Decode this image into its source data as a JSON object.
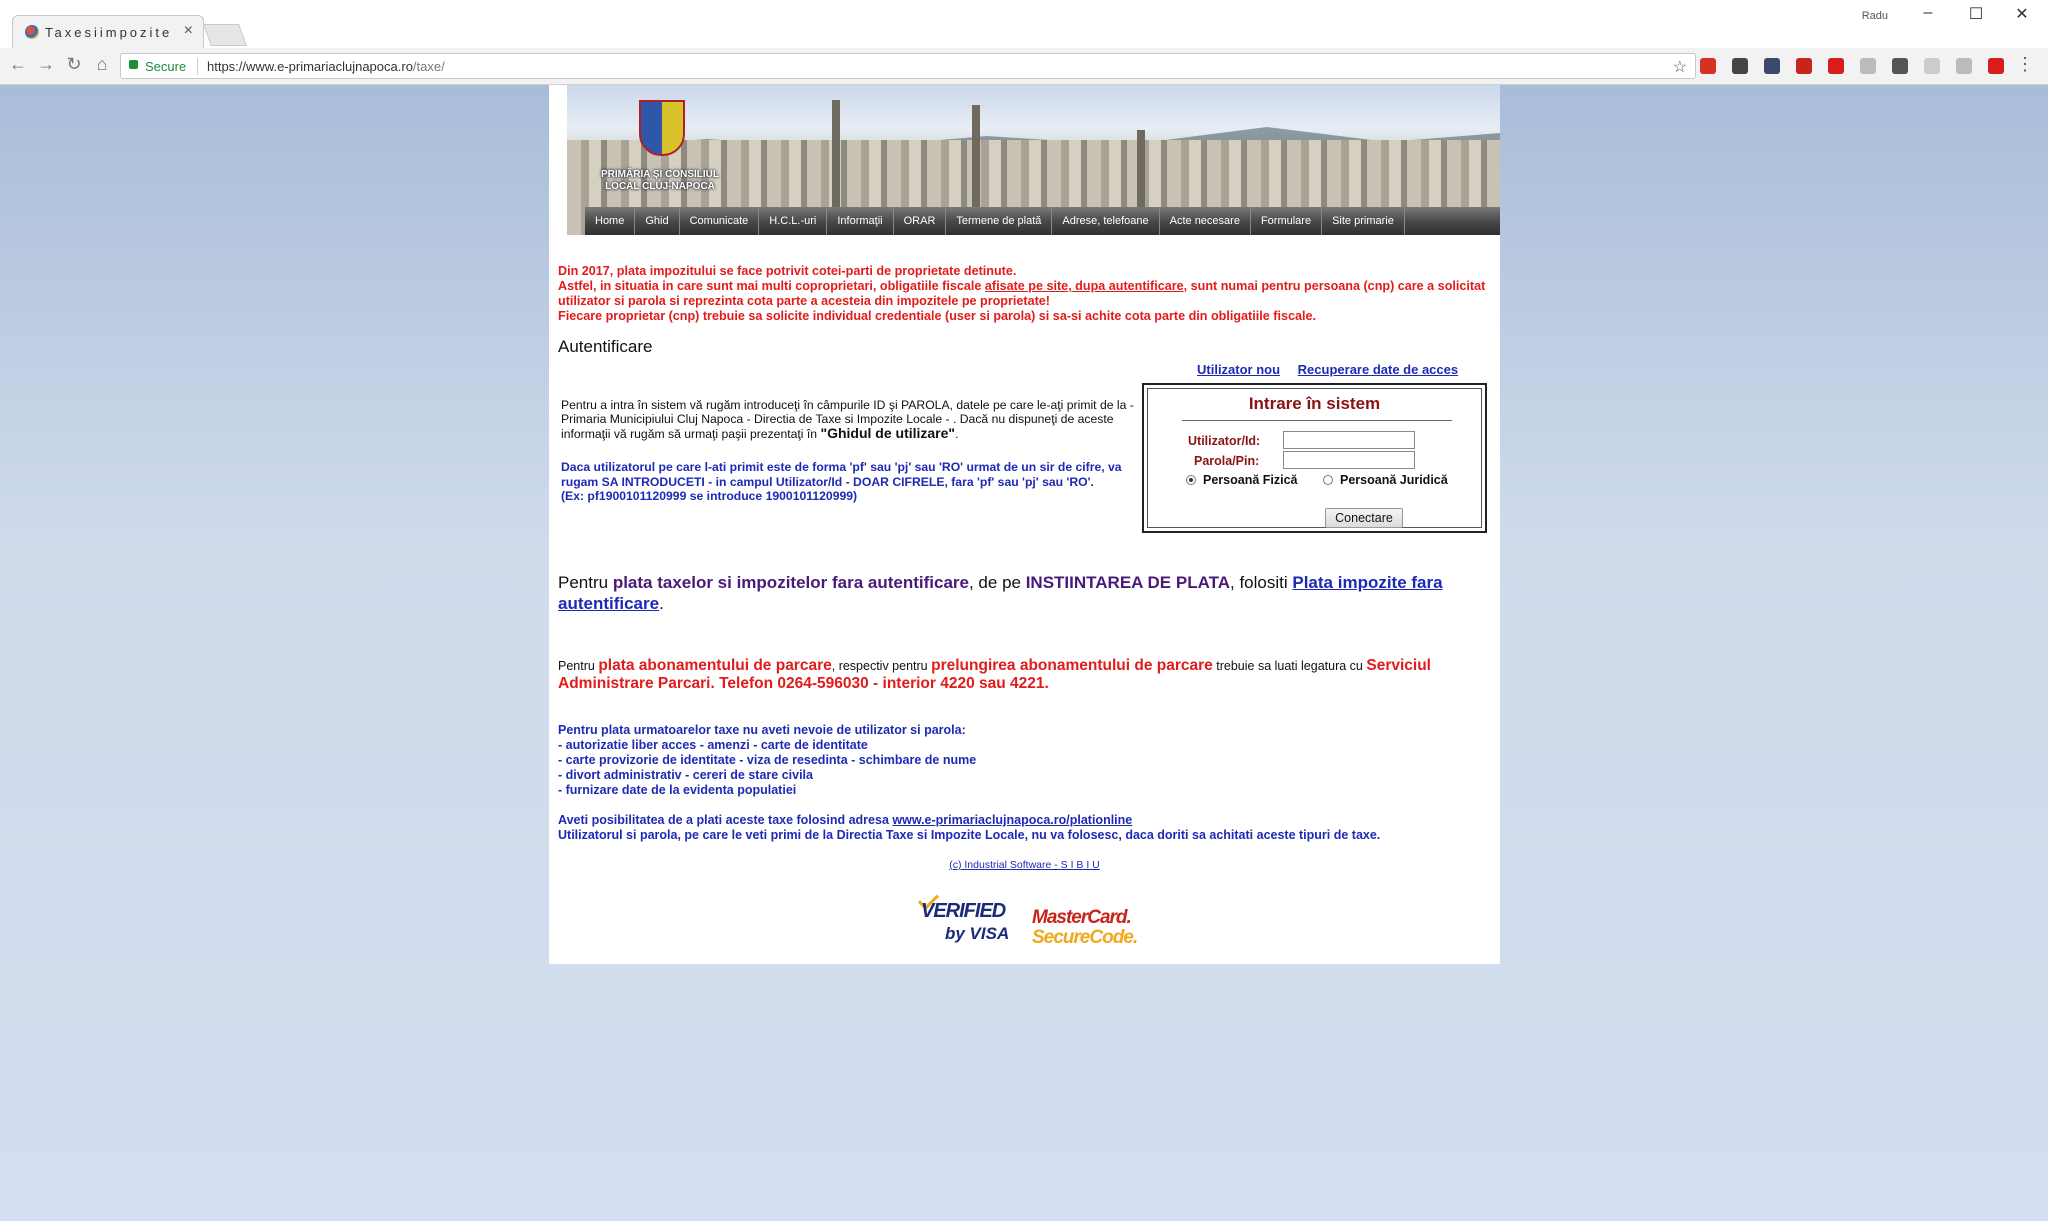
{
  "browser": {
    "tab_title": "Taxesiimpozite",
    "tab_close": "×",
    "user_name": "Radu",
    "window_controls": [
      "–",
      "☐",
      "✕"
    ],
    "secure_label": "Secure",
    "url_base": "https://www.e-primariaclujnapoca.ro",
    "url_path": "/taxe/",
    "extensions": [
      {
        "name": "gmail-icon",
        "color": "#d93025"
      },
      {
        "name": "pocket-icon",
        "color": "#444444"
      },
      {
        "name": "cloud-icon",
        "color": "#3a4a6a"
      },
      {
        "name": "reader-icon",
        "color": "#c8241c"
      },
      {
        "name": "adblock-icon",
        "color": "#d91c1c"
      },
      {
        "name": "bubble-icon",
        "color": "#bbbbbb"
      },
      {
        "name": "gear-ext-icon",
        "color": "#555555"
      },
      {
        "name": "r-ext-icon",
        "color": "#cccccc"
      },
      {
        "name": "rss-icon",
        "color": "#bbbbbb"
      },
      {
        "name": "red-square-icon",
        "color": "#d91c1c"
      }
    ]
  },
  "site": {
    "coat_label": "PRIMĂRIA ȘI CONSILIUL LOCAL CLUJ-NAPOCA",
    "nav": [
      "Home",
      "Ghid",
      "Comunicate",
      "H.C.L.-uri",
      "Informaţii",
      "ORAR",
      "Termene de plată",
      "Adrese, telefoane",
      "Acte necesare",
      "Formulare",
      "Site primarie"
    ]
  },
  "notice": {
    "line1": "Din 2017, plata impozitului se face potrivit cotei-parti de proprietate detinute.",
    "line2a": "Astfel, in situatia in care sunt mai multi coproprietari, obligatiile fiscale ",
    "line2_link": "afisate pe site, dupa autentificare",
    "line2b": ", sunt numai pentru persoana (cnp) care a solicitat utilizator si parola si reprezinta cota parte a acesteia din impozitele pe proprietate!",
    "line3": "Fiecare proprietar (cnp) trebuie sa solicite individual credentiale (user si parola) si sa-si achite cota parte din obligatiile fiscale."
  },
  "auth": {
    "title": "Autentificare",
    "link_new_user": "Utilizator nou",
    "link_recover": "Recuperare date de acces",
    "intro_text": "Pentru a intra în sistem vă rugăm introduceţi în câmpurile ID şi PAROLA, datele pe care le-aţi primit de la - Primaria Municipiului Cluj Napoca - Directia de Taxe si Impozite Locale - . Dacă nu dispuneţi de aceste informaţii vă rugăm să urmaţi paşii prezentaţi în ",
    "guide_label": "\"Ghidul de utilizare\"",
    "intro_end": ".",
    "hint_lines": [
      "Daca utilizatorul pe care l-ati primit este de forma 'pf' sau 'pj' sau 'RO' urmat de un sir de cifre, va rugam SA INTRODUCETI - in campul Utilizator/Id - DOAR CIFRELE, fara 'pf' sau 'pj' sau 'RO'.",
      "(Ex: pf1900101120999 se introduce 1900101120999)"
    ],
    "box_title": "Intrare în sistem",
    "user_label": "Utilizator/Id:",
    "pass_label": "Parola/Pin:",
    "user_value": "",
    "pass_value": "",
    "radio_fizica": "Persoană Fizică",
    "radio_juridica": "Persoană Juridică",
    "submit": "Conectare"
  },
  "plata": {
    "t1": "Pentru ",
    "t2": "plata taxelor si impozitelor fara autentificare",
    "t3": ", de pe ",
    "t4": "INSTIINTAREA DE PLATA",
    "t5": ", folositi ",
    "link": "Plata impozite fara autentificare",
    "t6": "."
  },
  "parcare": {
    "t1": "Pentru ",
    "t2": "plata abonamentului de parcare",
    "t3": ", respectiv pentru ",
    "t4": "prelungirea abonamentului de parcare",
    "t5": " trebuie sa luati legatura cu ",
    "t6": "Serviciul Administrare Parcari. Telefon 0264-596030 - interior 4220 sau 4221."
  },
  "taxe": {
    "heading": "Pentru plata urmatoarelor taxe nu aveti nevoie de utilizator si parola:",
    "items": [
      "- autorizatie liber acces - amenzi - carte de identitate",
      "- carte provizorie de identitate - viza de resedinta - schimbare de nume",
      "- divort administrativ - cereri de stare civila",
      "- furnizare date de la evidenta populatiei"
    ],
    "possibility": "Aveti posibilitatea de a plati aceste taxe folosind adresa ",
    "possibility_link": "www.e-primariaclujnapoca.ro/plationline",
    "last": "Utilizatorul si parola, pe care le veti primi de la Directia Taxe si Impozite Locale, nu va folosesc, daca doriti sa achitati aceste tipuri de taxe."
  },
  "footer": {
    "copyright": "(c) Industrial Software - S I B I U",
    "visa_1": "VERIFIED",
    "visa_2": "by VISA",
    "mc_1": "MasterCard.",
    "mc_2": "SecureCode."
  }
}
